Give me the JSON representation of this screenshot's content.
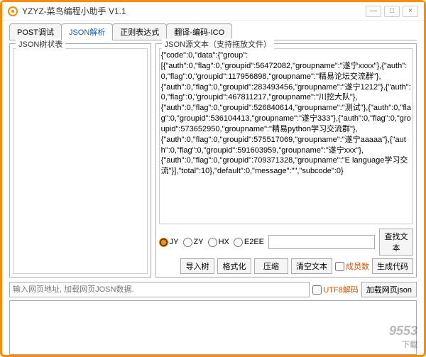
{
  "window": {
    "title": "YZYZ-菜鸟编程小助手 V1.1",
    "minimize": "—",
    "maximize": "□",
    "close": "×"
  },
  "tabs": {
    "t1": "POST调试",
    "t2": "JSON解析",
    "t3": "正则表达式",
    "t4": "翻译-编码-ICO"
  },
  "left": {
    "label": "JSON树状表"
  },
  "right": {
    "label": "JSON源文本（支持拖放文件）",
    "json_text": "{\"code\":0,\"data\":{\"group\":\n[{\"auth\":0,\"flag\":0,\"groupid\":56472082,\"groupname\":\"遂宁xxxx\"},{\"auth\":0,\"flag\":0,\"groupid\":117956898,\"groupname\":\"精易论坛交流群\"},\n{\"auth\":0,\"flag\":0,\"groupid\":283493456,\"groupname\":\"遂宁1212\"},{\"auth\":0,\"flag\":0,\"groupid\":467811217,\"groupname\":\"川挖大队\"},\n{\"auth\":0,\"flag\":0,\"groupid\":526840614,\"groupname\":\"测试\"},{\"auth\":0,\"flag\":0,\"groupid\":536104413,\"groupname\":\"遂宁333\"},{\"auth\":0,\"flag\":0,\"groupid\":573652950,\"groupname\":\"精易python学习交流群\"},\n{\"auth\":0,\"flag\":0,\"groupid\":575517069,\"groupname\":\"遂宁aaaaa\"},{\"auth\":0,\"flag\":0,\"groupid\":591603959,\"groupname\":\"遂宁xxx\"},\n{\"auth\":0,\"flag\":0,\"groupid\":709371328,\"groupname\":\"E language学习交\n流\"}],\"total\":10},\"default\":0,\"message\":\"\",\"subcode\":0}"
  },
  "radios": {
    "jy": "JY",
    "zy": "ZY",
    "hx": "HX",
    "e2ee": "E2EE"
  },
  "buttons": {
    "find": "查找文本",
    "import_tree": "导入树",
    "format": "格式化",
    "compress": "压缩",
    "clear": "清空文本",
    "members": "成员数",
    "gen_code": "生成代码",
    "load_json": "加载网页json"
  },
  "checks": {
    "members": "成员数",
    "utf8": "UTF8解码"
  },
  "url": {
    "placeholder": "输入网页地址, 加载网页JOSN数据."
  },
  "watermark": {
    "main": "9553",
    "sub": "下载"
  }
}
